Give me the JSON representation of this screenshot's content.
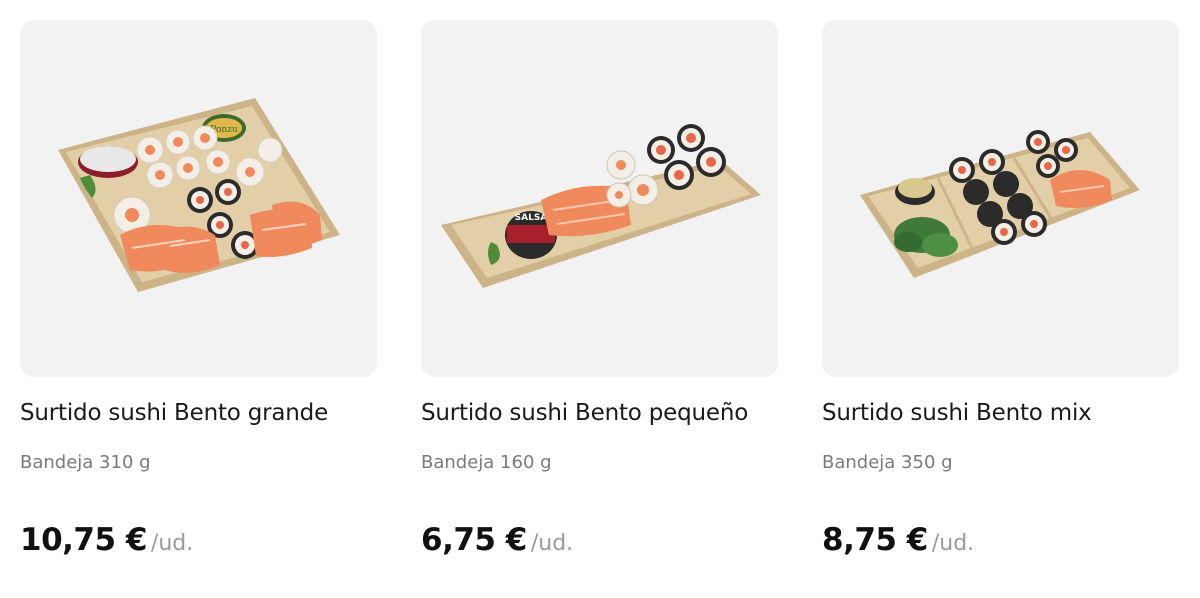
{
  "products": [
    {
      "name": "Surtido sushi Bento grande",
      "size": "Bandeja 310 g",
      "price": "10,75 €",
      "unit": "/ud.",
      "image_icon": "sushi-tray-large-image",
      "label_text": "Ponzu"
    },
    {
      "name": "Surtido sushi Bento pequeño",
      "size": "Bandeja 160 g",
      "price": "6,75 €",
      "unit": "/ud.",
      "image_icon": "sushi-tray-small-image",
      "label_text": "SALSA"
    },
    {
      "name": "Surtido sushi Bento mix",
      "size": "Bandeja 350 g",
      "price": "8,75 €",
      "unit": "/ud.",
      "image_icon": "sushi-tray-mix-image"
    }
  ],
  "colors": {
    "card_background": "#f2f2f2",
    "tray": "#d9c29a",
    "salmon": "#f08a5d",
    "nori": "#2b2b2b",
    "rice": "#f4efe6",
    "seaweed_salad": "#3f7a3a"
  }
}
